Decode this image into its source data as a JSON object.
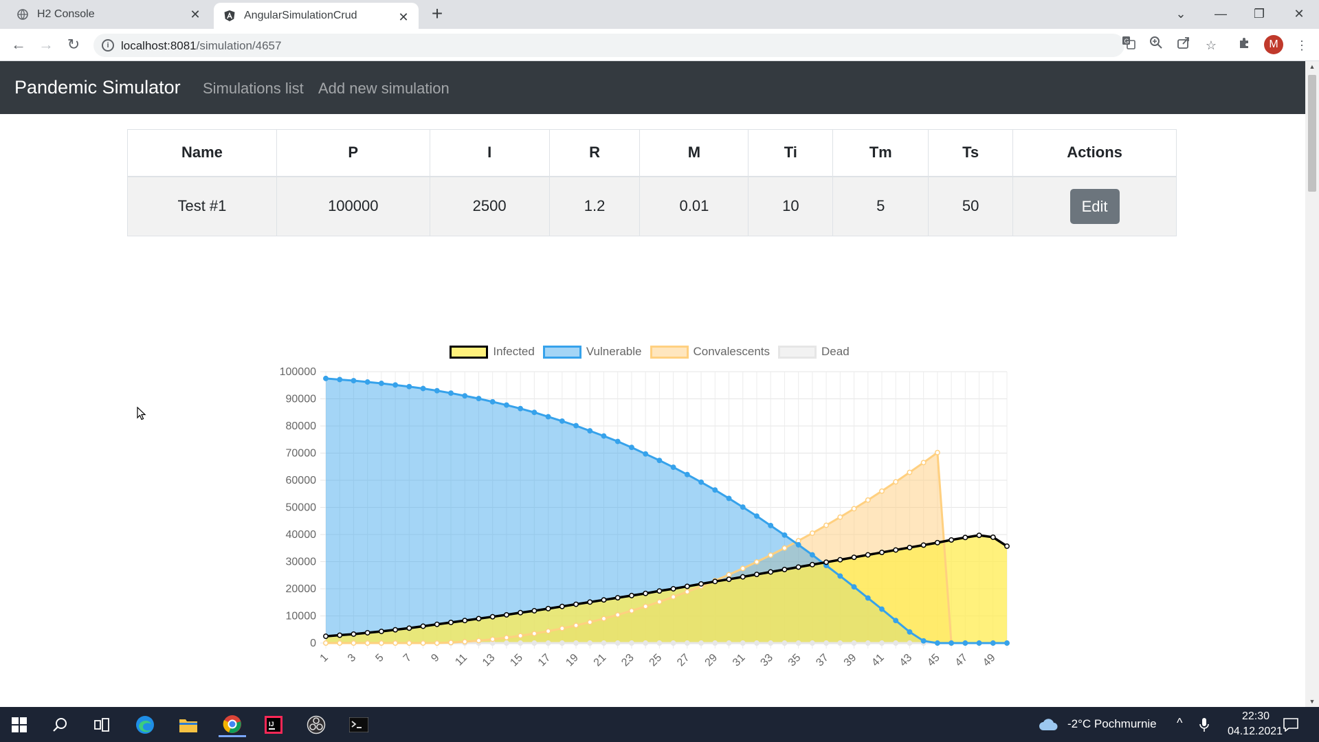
{
  "browser": {
    "tabs": [
      {
        "title": "H2 Console",
        "icon": "globe-icon",
        "active": false
      },
      {
        "title": "AngularSimulationCrud",
        "icon": "angular-icon",
        "active": true
      }
    ],
    "url_host": "localhost:8081",
    "url_path": "/simulation/4657",
    "profile_initial": "M"
  },
  "navbar": {
    "brand": "Pandemic Simulator",
    "links": [
      "Simulations list",
      "Add new simulation"
    ]
  },
  "table": {
    "headers": [
      "Name",
      "P",
      "I",
      "R",
      "M",
      "Ti",
      "Tm",
      "Ts",
      "Actions"
    ],
    "row": [
      "Test #1",
      "100000",
      "2500",
      "1.2",
      "0.01",
      "10",
      "5",
      "50"
    ],
    "edit_label": "Edit"
  },
  "chart_data": {
    "type": "line",
    "legend_position": "top",
    "grid": true,
    "ylim": [
      0,
      100000
    ],
    "yticks": [
      "0",
      "10000",
      "20000",
      "30000",
      "40000",
      "50000",
      "60000",
      "70000",
      "80000",
      "90000",
      "100000"
    ],
    "xticks": [
      "1",
      "3",
      "5",
      "7",
      "9",
      "11",
      "13",
      "15",
      "17",
      "19",
      "21",
      "23",
      "25",
      "27",
      "29",
      "31",
      "33",
      "35",
      "37",
      "39",
      "41",
      "43",
      "45",
      "47",
      "49"
    ],
    "x_count": 50,
    "series": [
      {
        "name": "Infected",
        "stroke": "#000000",
        "fill": "rgba(255,236,80,0.75)",
        "values": [
          2500,
          2900,
          3300,
          3800,
          4300,
          4900,
          5500,
          6200,
          6900,
          7600,
          8300,
          9000,
          9700,
          10400,
          11200,
          11900,
          12700,
          13500,
          14300,
          15100,
          15900,
          16700,
          17500,
          18300,
          19200,
          20000,
          20900,
          21800,
          22700,
          23500,
          24400,
          25300,
          26200,
          27100,
          28000,
          28900,
          29800,
          30700,
          31600,
          32500,
          33400,
          34300,
          35200,
          36100,
          37000,
          38000,
          38900,
          39700,
          39000,
          35700
        ]
      },
      {
        "name": "Vulnerable",
        "stroke": "#36a2eb",
        "fill": "rgba(54,162,235,0.45)",
        "values": [
          97500,
          97100,
          96700,
          96200,
          95700,
          95100,
          94500,
          93800,
          93000,
          92100,
          91100,
          90100,
          88900,
          87700,
          86400,
          85000,
          83400,
          81800,
          80100,
          78200,
          76300,
          74300,
          72100,
          69700,
          67300,
          64800,
          62100,
          59300,
          56400,
          53300,
          50100,
          46800,
          43300,
          39800,
          36200,
          32500,
          28600,
          24700,
          20700,
          16600,
          12500,
          8300,
          4100,
          800,
          0,
          0,
          0,
          0,
          0,
          0
        ]
      },
      {
        "name": "Convalescents",
        "stroke": "#ffd080",
        "fill": "rgba(255,206,126,0.5)",
        "values": [
          0,
          0,
          0,
          0,
          0,
          0,
          0,
          0,
          0,
          200,
          500,
          900,
          1400,
          2000,
          2700,
          3500,
          4400,
          5400,
          6500,
          7700,
          9000,
          10400,
          11900,
          13500,
          15200,
          17000,
          18900,
          20900,
          23000,
          25200,
          27500,
          29900,
          32400,
          35000,
          37700,
          40500,
          43400,
          46400,
          49500,
          52700,
          56000,
          59400,
          62900,
          66500,
          70200,
          0,
          0,
          0,
          0,
          0
        ]
      },
      {
        "name": "Dead",
        "stroke": "#e6e6e6",
        "fill": "rgba(230,230,230,0.5)",
        "values": [
          0,
          0,
          0,
          0,
          0,
          0,
          0,
          0,
          0,
          0,
          0,
          0,
          0,
          0,
          0,
          0,
          0,
          0,
          0,
          0,
          0,
          0,
          0,
          0,
          0,
          0,
          0,
          0,
          0,
          0,
          0,
          0,
          0,
          0,
          0,
          0,
          0,
          0,
          0,
          0,
          0,
          0,
          0,
          0,
          0,
          0,
          0,
          0,
          0,
          0
        ]
      }
    ]
  },
  "tray": {
    "weather": "-2°C  Pochmurnie",
    "time": "22:30",
    "date": "04.12.2021"
  }
}
